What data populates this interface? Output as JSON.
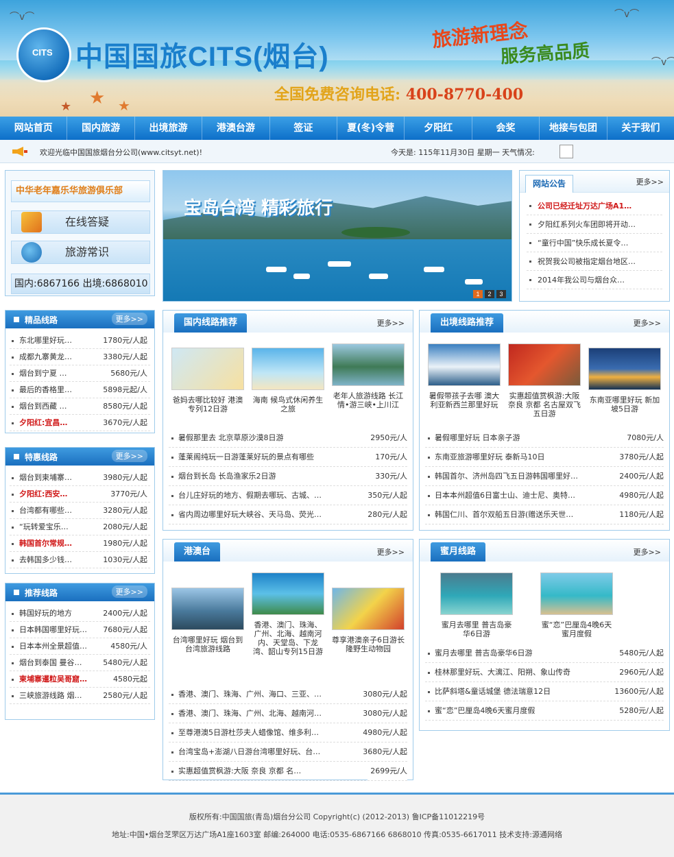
{
  "header": {
    "logo_text": "中国国旅CITS(烟台)",
    "logo_badge": "CITS",
    "slogan_1": "旅游新理念",
    "slogan_2": "服务高品质",
    "hotline_label": "全国免费咨询电话:",
    "hotline_number": "400-8770-400"
  },
  "nav": [
    "网站首页",
    "国内旅游",
    "出境旅游",
    "港澳台游",
    "签证",
    "夏(冬)令营",
    "夕阳红",
    "会奖",
    "地接与包团",
    "关于我们"
  ],
  "info": {
    "welcome": "欢迎光临中国国旅烟台分公司(www.citsyt.net)!",
    "date": "今天是: 115年11月30日 星期一 天气情况:"
  },
  "club": {
    "title": "中华老年嘉乐华旅游俱乐部",
    "btn_qa": "在线答疑",
    "btn_knowledge": "旅游常识",
    "phones": "国内:6867166 出境:6868010"
  },
  "hero": {
    "caption": "宝岛台湾 精彩旅行",
    "pages": [
      "1",
      "2",
      "3"
    ]
  },
  "notice": {
    "title": "网站公告",
    "more": "更多>>",
    "items": [
      "公司已经迁址万达广场A1…",
      "夕阳红系列火车团即将开动…",
      "“童行中国”快乐成长夏令…",
      "祝贺我公司被指定烟台地区…",
      "2014年我公司与烟台众…"
    ]
  },
  "premium": {
    "title": "精品线路",
    "more": "更多>>",
    "items": [
      {
        "name": "东北哪里好玩…",
        "price": "1780元/人起"
      },
      {
        "name": "成都九寨黄龙…",
        "price": "3380元/人起"
      },
      {
        "name": "烟台到宁夏 …",
        "price": "5680元/人"
      },
      {
        "name": "最后的香格里…",
        "price": "5898元起/人"
      },
      {
        "name": "烟台到西藏 …",
        "price": "8580元/人起"
      },
      {
        "name": "夕阳红:宜昌…",
        "price": "3670元/人起"
      }
    ]
  },
  "special": {
    "title": "特惠线路",
    "more": "更多>>",
    "items": [
      {
        "name": "烟台到柬埔寨…",
        "price": "3980元/人起"
      },
      {
        "name": "夕阳红:西安…",
        "price": "3770元/人"
      },
      {
        "name": "台湾都有哪些…",
        "price": "3280元/人起"
      },
      {
        "name": "“玩转爱宝乐…",
        "price": "2080元/人起"
      },
      {
        "name": "韩国首尔常规…",
        "price": "1980元/人起"
      },
      {
        "name": "去韩国多少钱…",
        "price": "1030元/人起"
      }
    ]
  },
  "recommend": {
    "title": "推荐线路",
    "more": "更多>>",
    "items": [
      {
        "name": "韩国好玩的地方",
        "price": "2400元/人起"
      },
      {
        "name": "日本韩国哪里好玩…",
        "price": "7680元/人起"
      },
      {
        "name": "日本本州全景超值…",
        "price": "4580元/人"
      },
      {
        "name": "烟台到泰国 曼谷…",
        "price": "5480元/人起"
      },
      {
        "name": "柬埔寨暹粒吴哥窟…",
        "price": "4580元起"
      },
      {
        "name": "三峡旅游线路 烟…",
        "price": "2580元/人起"
      }
    ]
  },
  "domestic": {
    "title": "国内线路推荐",
    "more": "更多>>",
    "thumbs": [
      "爸妈去哪比较好 港澳专列12日游",
      "海南 候鸟式休闲养生之旅",
      "老年人旅游线路 长江情•游三峡•上川江"
    ],
    "items": [
      {
        "name": "暑假那里去 北京草原沙漠8日游",
        "price": "2950元/人"
      },
      {
        "name": "蓬莱阁纯玩一日游蓬莱好玩的景点有哪些",
        "price": "170元/人"
      },
      {
        "name": "烟台到长岛 长岛渔家乐2日游",
        "price": "330元/人"
      },
      {
        "name": "台儿庄好玩的地方、假期去哪玩、古城、…",
        "price": "350元/人起"
      },
      {
        "name": "省内周边哪里好玩大峡谷、天马岛、荧光…",
        "price": "280元/人起"
      }
    ]
  },
  "outbound": {
    "title": "出境线路推荐",
    "more": "更多>>",
    "thumbs": [
      "暑假带孩子去哪 澳大利亚新西兰那里好玩",
      "实惠超值赏枫游:大阪 奈良 京都 名古屋双飞五日游",
      "东南亚哪里好玩 新加坡5日游"
    ],
    "items": [
      {
        "name": "暑假哪里好玩 日本亲子游",
        "price": "7080元/人"
      },
      {
        "name": "东南亚旅游哪里好玩 泰新马10日",
        "price": "3780元/人起"
      },
      {
        "name": "韩国首尔、济州岛四飞五日游韩国哪里好…",
        "price": "2400元/人起"
      },
      {
        "name": "日本本州超值6日富士山、迪士尼、奥特…",
        "price": "4980元/人起"
      },
      {
        "name": "韩国仁川、首尔双船五日游(赠送乐天世…",
        "price": "1180元/人起"
      }
    ]
  },
  "hkmacau": {
    "title": "港澳台",
    "more": "更多>>",
    "thumbs": [
      "台湾哪里好玩 烟台到台湾旅游线路",
      "香港、澳门、珠海、广州、北海、越南河内、天堂岛、下龙湾、韶山专列15日游",
      "尊享港澳亲子6日游长隆野生动物园"
    ],
    "items": [
      {
        "name": "香港、澳门、珠海、广州、海口、三亚、…",
        "price": "3080元/人起"
      },
      {
        "name": "香港、澳门、珠海、广州、北海、越南河…",
        "price": "3080元/人起"
      },
      {
        "name": "至尊港澳5日游杜莎夫人蜡像馆、维多利…",
        "price": "4980元/人起"
      },
      {
        "name": "台湾宝岛+澎湖八日游台湾哪里好玩、台…",
        "price": "3680元/人起"
      },
      {
        "name": "实惠超值赏枫游:大阪 奈良 京都 名…",
        "price": "2699元/人"
      }
    ]
  },
  "honeymoon": {
    "title": "蜜月线路",
    "more": "更多>>",
    "thumbs": [
      "蜜月去哪里 普吉岛豪华6日游",
      "蜜“恋”巴厘岛4晚6天蜜月度假"
    ],
    "items": [
      {
        "name": "蜜月去哪里 普吉岛豪华6日游",
        "price": "5480元/人起"
      },
      {
        "name": "桂林那里好玩、大漓江、阳朔、象山传奇",
        "price": "2960元/人起"
      },
      {
        "name": "比萨斜塔&童话城堡 德法瑞意12日",
        "price": "13600元/人起"
      },
      {
        "name": "蜜“恋”巴厘岛4晚6天蜜月度假",
        "price": "5280元/人起"
      }
    ]
  },
  "footer": {
    "line1": "版权所有:中国国旅(青岛)烟台分公司 Copyright(c) (2012-2013) 鲁ICP备11012219号",
    "line2": "地址:中国•烟台芝罘区万达广场A1座1603室 邮编:264000 电话:0535-6867166 6868010 传真:0535-6617011 技术支持:源通网络"
  }
}
